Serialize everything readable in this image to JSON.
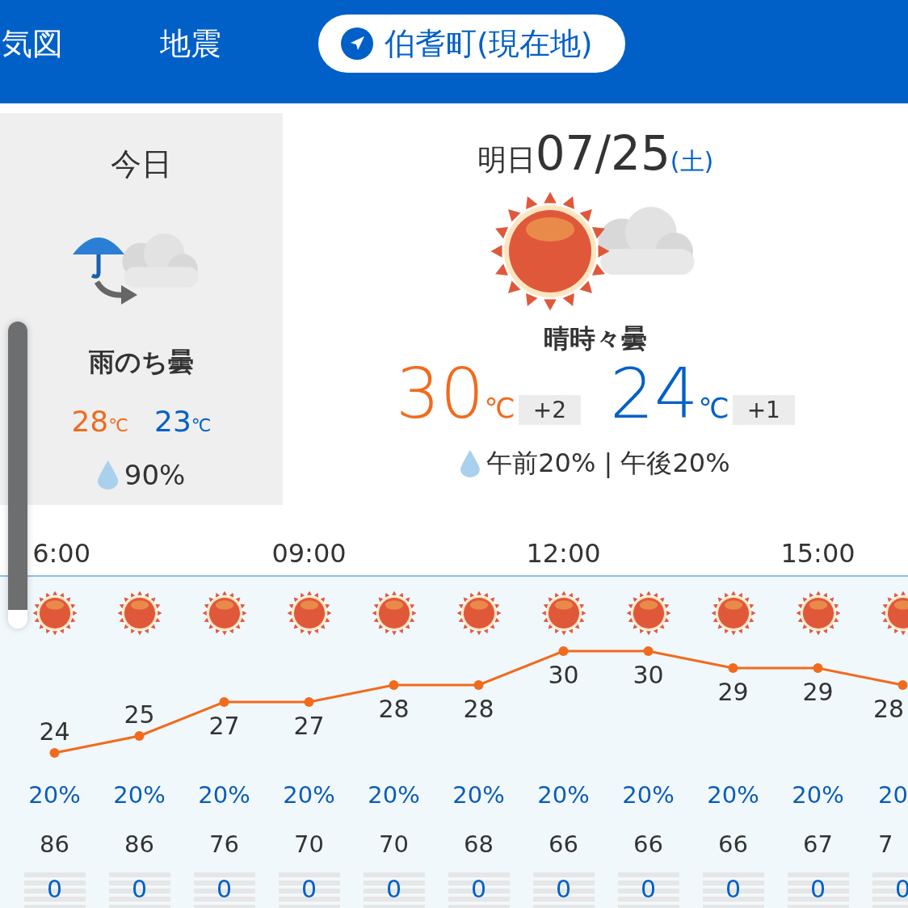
{
  "header": {
    "tabs": [
      {
        "label": "気図",
        "selected": false,
        "kind": "plain"
      },
      {
        "label": "地震",
        "selected": false,
        "kind": "plain"
      },
      {
        "label": "伯耆町(現在地)",
        "selected": true,
        "kind": "location"
      }
    ]
  },
  "today": {
    "title": "今日",
    "kind": "rain-then-cloudy",
    "weather": "雨のち曇",
    "high": "28",
    "low": "23",
    "unit": "℃",
    "rain": "90%"
  },
  "tomorrow": {
    "title": "明日",
    "date": "07/25",
    "weekday": "(土)",
    "kind": "sunny-cloudy",
    "weather": "晴時々曇",
    "high": "30",
    "high_diff": "+2",
    "low": "24",
    "low_diff": "+1",
    "unit": "℃",
    "rain": "午前20% | 午後20%"
  },
  "hourly": [
    {
      "time": "6:00",
      "kind": "sunny",
      "rain": "20%",
      "humidity": "86",
      "precip": "0"
    },
    {
      "kind": "sunny",
      "rain": "20%",
      "humidity": "86",
      "precip": "0"
    },
    {
      "kind": "sunny",
      "rain": "20%",
      "humidity": "76",
      "precip": "0"
    },
    {
      "time": "09:00",
      "kind": "sunny",
      "rain": "20%",
      "humidity": "70",
      "precip": "0"
    },
    {
      "kind": "sunny",
      "rain": "20%",
      "humidity": "70",
      "precip": "0"
    },
    {
      "kind": "sunny",
      "rain": "20%",
      "humidity": "68",
      "precip": "0"
    },
    {
      "time": "12:00",
      "kind": "sunny",
      "rain": "20%",
      "humidity": "66",
      "precip": "0"
    },
    {
      "kind": "sunny",
      "rain": "20%",
      "humidity": "66",
      "precip": "0"
    },
    {
      "kind": "sunny",
      "rain": "20%",
      "humidity": "66",
      "precip": "0"
    },
    {
      "time": "15:00",
      "kind": "sunny",
      "rain": "20%",
      "humidity": "67",
      "precip": "0"
    },
    {
      "kind": "sunny",
      "rain": "20",
      "humidity": "7",
      "precip": "0"
    }
  ],
  "chart_data": {
    "type": "line",
    "series": [
      {
        "color": "#f26a1b",
        "marker": "circle",
        "values": [
          24,
          25,
          27,
          27,
          28,
          28,
          30,
          30,
          29,
          29,
          28
        ]
      }
    ],
    "data_labels": true
  }
}
